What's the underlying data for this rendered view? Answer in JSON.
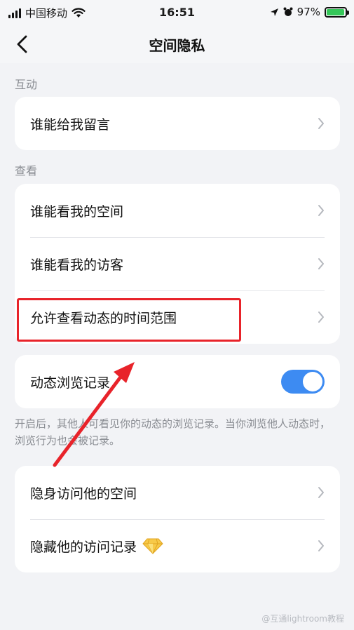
{
  "status_bar": {
    "carrier": "中国移动",
    "time": "16:51",
    "battery": "97%",
    "battery_level": 0.97
  },
  "nav": {
    "title": "空间隐私",
    "back_icon": "chevron-left-icon"
  },
  "sections": {
    "interaction": {
      "label": "互动",
      "items": [
        {
          "label": "谁能给我留言"
        }
      ]
    },
    "view": {
      "label": "查看",
      "items": [
        {
          "label": "谁能看我的空间"
        },
        {
          "label": "谁能看我的访客"
        },
        {
          "label": "允许查看动态的时间范围"
        }
      ]
    },
    "browse": {
      "label": "动态浏览记录",
      "toggle_on": true,
      "description": "开启后，其他人可看见你的动态的浏览记录。当你浏览他人动态时，浏览行为也会被记录。"
    },
    "invisible": {
      "items": [
        {
          "label": "隐身访问他的空间"
        },
        {
          "label": "隐藏他的访问记录",
          "badge_icon": "diamond-icon"
        }
      ]
    }
  },
  "annotation": {
    "highlight_color": "#e8232a"
  },
  "watermark": "@互通lightroom教程",
  "colors": {
    "accent": "#3d8bf2",
    "background": "#f2f3f6",
    "highlight": "#e8232a"
  }
}
